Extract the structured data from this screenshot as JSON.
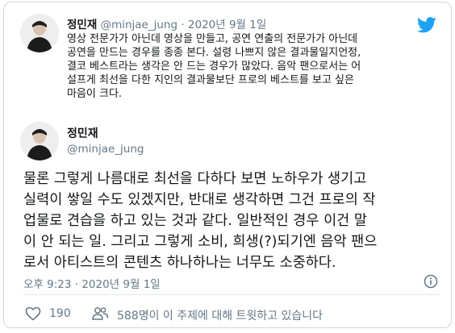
{
  "colors": {
    "twitter_blue": "#1da1f2",
    "text_primary": "#14171a",
    "text_secondary": "#657786",
    "border": "#cfd9de"
  },
  "quoted_tweet": {
    "name": "정민재",
    "meta": "@minjae_jung · 2020년 9월 1일",
    "lines": [
      "영상 전문가가 아닌데 영상을 만들고, 공연 연출의 전문가가 아닌데",
      "공연을 만드는 경우를 종종 본다. 설령 나쁘지 않은 결과물일지언정,",
      "결코 베스트라는 생각은 안 드는 경우가 많았다. 음악 팬으로서는 어",
      "설프게 최선을 다한 지인의 결과물보단 프로의 베스트를 보고 싶은",
      "마음이 크다."
    ]
  },
  "main_tweet": {
    "name": "정민재",
    "handle": "@minjae_jung",
    "lines": [
      "물론 그렇게 나름대로 최선을 다하다 보면 노하우가 생기고",
      "실력이 쌓일 수도 있겠지만, 반대로 생각하면 그건 프로의 작",
      "업물로 견습을 하고 있는 것과 같다. 일반적인 경우 이건 말",
      "이 안 되는 일. 그리고 그렇게 소비, 희생(?)되기엔 음악 팬으",
      "로서 아티스트의 콘텐츠 하나하나는 너무도 소중하다."
    ],
    "timestamp": "오후 9:23 · 2020년 9월 1일"
  },
  "actions": {
    "like_count": "190",
    "people_talking": "588명이 이 주제에 대해 트윗하고 있습니다"
  },
  "icons": {
    "logo": "twitter-bird-icon",
    "info": "info-icon",
    "like": "heart-icon",
    "people": "people-icon",
    "avatar": "avatar-icon"
  }
}
